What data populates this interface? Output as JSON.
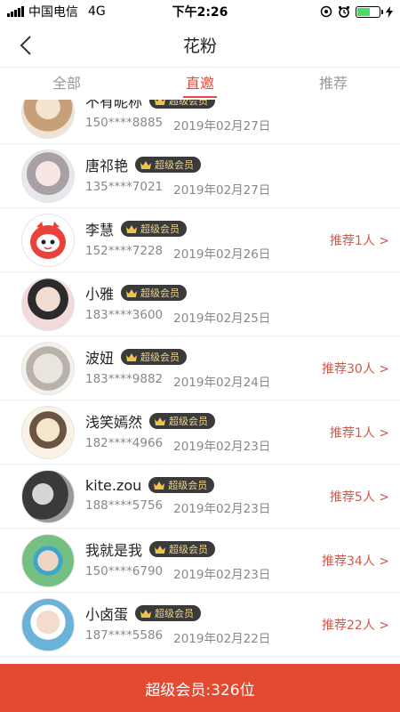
{
  "status_bar": {
    "carrier": "中国电信",
    "network": "4G",
    "time": "下午2:26",
    "battery_level": 0.6
  },
  "header": {
    "title": "花粉",
    "back_icon": "chevron-left-icon"
  },
  "tabs": [
    {
      "label": "全部",
      "active": false
    },
    {
      "label": "直邀",
      "active": true
    },
    {
      "label": "推荐",
      "active": false
    }
  ],
  "badge_label": "超级会员",
  "members": [
    {
      "name": "不有昵称",
      "phone": "150****8885",
      "date": "2019年02月27日",
      "recommend": ""
    },
    {
      "name": "唐祁艳",
      "phone": "135****7021",
      "date": "2019年02月27日",
      "recommend": ""
    },
    {
      "name": "李慧",
      "phone": "152****7228",
      "date": "2019年02月26日",
      "recommend": "推荐1人 >"
    },
    {
      "name": "小雅",
      "phone": "183****3600",
      "date": "2019年02月25日",
      "recommend": ""
    },
    {
      "name": "波妞",
      "phone": "183****9882",
      "date": "2019年02月24日",
      "recommend": "推荐30人 >"
    },
    {
      "name": "浅笑嫣然",
      "phone": "182****4966",
      "date": "2019年02月23日",
      "recommend": "推荐1人 >"
    },
    {
      "name": "kite.zou",
      "phone": "188****5756",
      "date": "2019年02月23日",
      "recommend": "推荐5人 >"
    },
    {
      "name": "我就是我",
      "phone": "150****6790",
      "date": "2019年02月23日",
      "recommend": "推荐34人 >"
    },
    {
      "name": "小卤蛋",
      "phone": "187****5586",
      "date": "2019年02月22日",
      "recommend": "推荐22人 >"
    }
  ],
  "footer": {
    "summary": "超级会员:326位"
  },
  "colors": {
    "accent": "#e74c3c",
    "footer": "#e24a31",
    "badge_bg": "#3a3a3a",
    "badge_text": "#f1d28a"
  }
}
